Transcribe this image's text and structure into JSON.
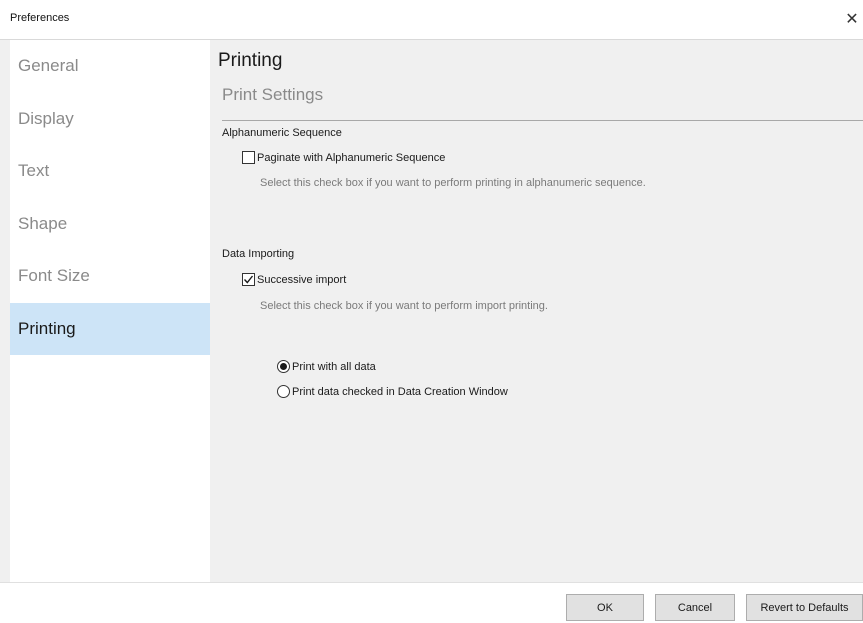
{
  "window": {
    "title": "Preferences",
    "close_glyph": "✕"
  },
  "sidebar": {
    "items": [
      {
        "label": "General",
        "selected": false
      },
      {
        "label": "Display",
        "selected": false
      },
      {
        "label": "Text",
        "selected": false
      },
      {
        "label": "Shape",
        "selected": false
      },
      {
        "label": "Font Size",
        "selected": false
      },
      {
        "label": "Printing",
        "selected": true
      }
    ]
  },
  "main": {
    "page_title": "Printing",
    "section_title": "Print Settings",
    "alphanumeric": {
      "group_label": "Alphanumeric Sequence",
      "checkbox_label": "Paginate with Alphanumeric Sequence",
      "checked": false,
      "description": "Select this check box if you want to perform printing in alphanumeric sequence."
    },
    "data_importing": {
      "group_label": "Data Importing",
      "checkbox_label": "Successive import",
      "checked": true,
      "description": "Select this check box if you want to perform import printing.",
      "radio_options": [
        {
          "label": "Print with all data",
          "selected": true
        },
        {
          "label": "Print data checked in Data Creation Window",
          "selected": false
        }
      ]
    }
  },
  "footer": {
    "ok_label": "OK",
    "cancel_label": "Cancel",
    "revert_label": "Revert to Defaults"
  },
  "colors": {
    "sidebar_selected": "#cde4f7",
    "panel_background": "#f0f0f0",
    "button_face": "#e1e1e1"
  }
}
